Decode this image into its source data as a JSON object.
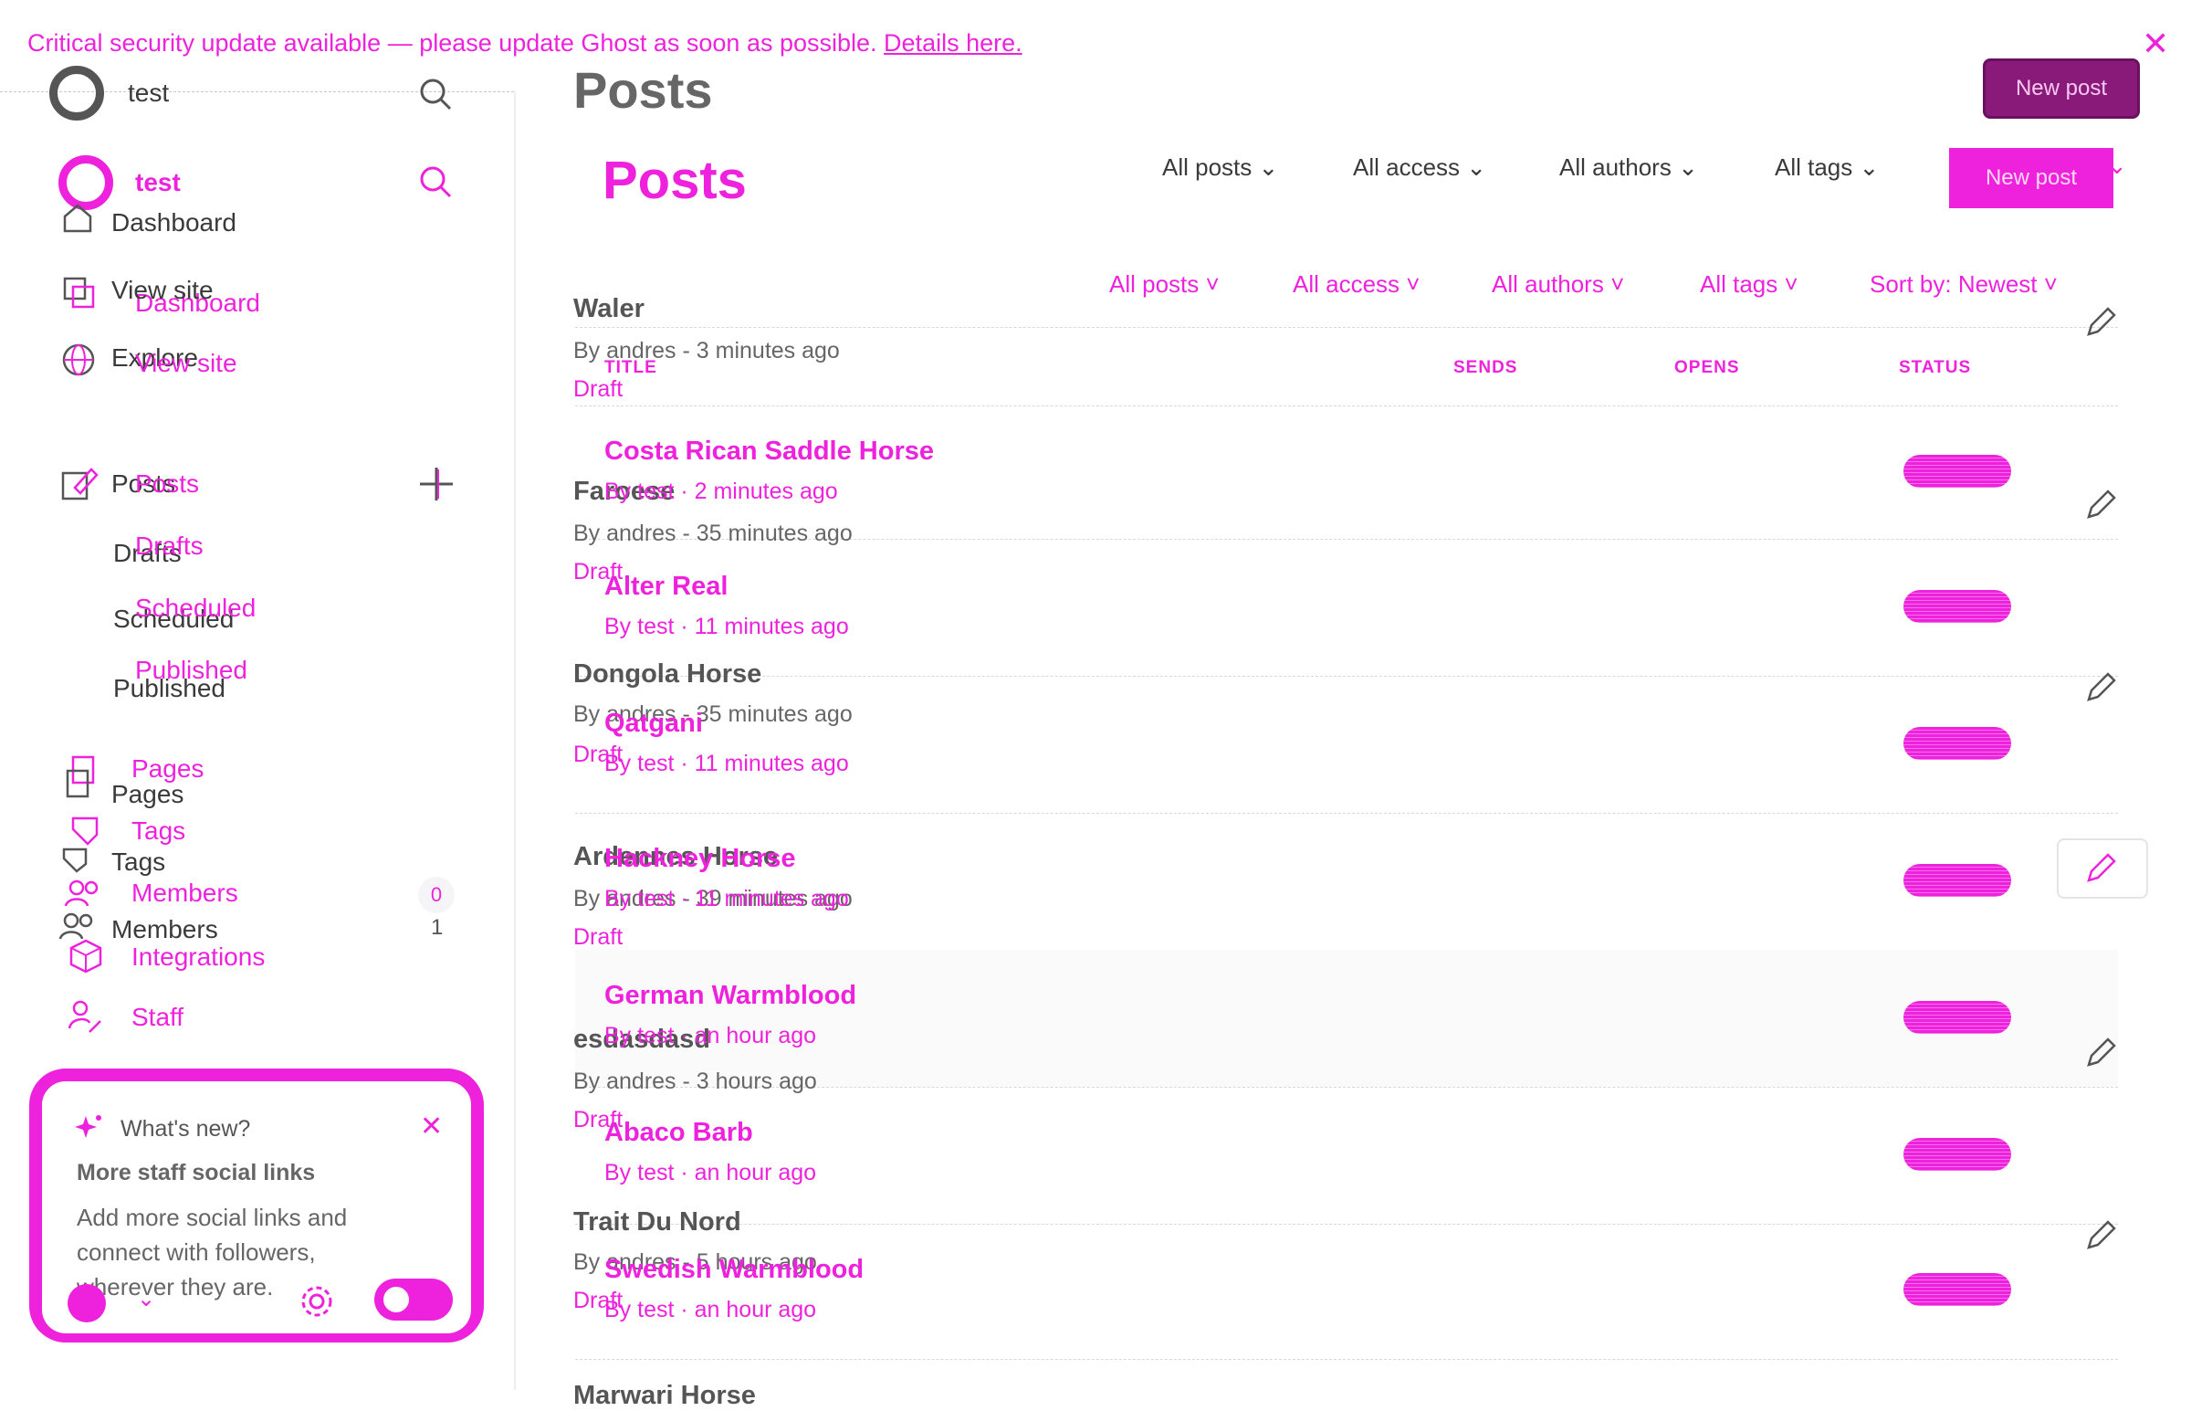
{
  "banner": {
    "message": "Critical security update available — please update Ghost as soon as possible.",
    "link": "Details here."
  },
  "sidebar": {
    "site_name": "test",
    "dashboard": "Dashboard",
    "view_site": "View site",
    "explore": "Explore",
    "posts": "Posts",
    "drafts": "Drafts",
    "scheduled": "Scheduled",
    "published": "Published",
    "pages": "Pages",
    "tags": "Tags",
    "members": "Members",
    "members_count_a": "0",
    "members_count_b": "1",
    "integrations": "Integrations",
    "staff": "Staff"
  },
  "whats_new": {
    "heading": "What's new?",
    "title": "More staff social links",
    "body_line1": "Add more social links and",
    "body_line2": "connect with followers,",
    "body_line3": "wherever they are."
  },
  "header": {
    "title": "Posts",
    "new_post": "New post"
  },
  "filters": {
    "all_posts": "All posts",
    "all_access": "All access",
    "all_authors": "All authors",
    "all_tags": "All tags",
    "sort": "Sort by: Newest"
  },
  "columns": {
    "title": "TITLE",
    "sends": "SENDS",
    "opens": "OPENS",
    "status": "STATUS"
  },
  "posts_a": [
    {
      "title": "Waler",
      "meta": "By andres - 3 minutes ago",
      "status": "Draft"
    },
    {
      "title": "Faroese",
      "meta": "By andres - 35 minutes ago",
      "status": "Draft"
    },
    {
      "title": "Dongola Horse",
      "meta": "By andres - 35 minutes ago",
      "status": "Draft"
    },
    {
      "title": "Ardennes Horse",
      "meta": "By andres - 39 minutes ago",
      "status": "Draft"
    },
    {
      "title": "esdasdasd",
      "meta": "By andres - 3 hours ago",
      "status": "Draft"
    },
    {
      "title": "Trait Du Nord",
      "meta": "By andres - 5 hours ago",
      "status": "Draft"
    },
    {
      "title": "Marwari Horse",
      "meta": "",
      "status": ""
    }
  ],
  "posts_b": [
    {
      "title": "Costa Rican Saddle Horse",
      "meta": "By test · 2 minutes ago"
    },
    {
      "title": "Alter Real",
      "meta": "By test · 11 minutes ago"
    },
    {
      "title": "Qatgani",
      "meta": "By test · 11 minutes ago"
    },
    {
      "title": "Hackney Horse",
      "meta": "By test · 11 minutes ago"
    },
    {
      "title": "German Warmblood",
      "meta": "By test · an hour ago"
    },
    {
      "title": "Abaco Barb",
      "meta": "By test · an hour ago"
    },
    {
      "title": "Swedish Warmblood",
      "meta": "By test · an hour ago"
    }
  ],
  "colors": {
    "accent": "#ee22dd",
    "text": "#15171a"
  },
  "icons": [
    "search-icon",
    "home-icon",
    "view-site-icon",
    "globe-icon",
    "posts-icon",
    "plus-icon",
    "page-icon",
    "tag-icon",
    "members-icon",
    "integrations-icon",
    "staff-icon",
    "sparkle-icon",
    "close-icon",
    "gear-icon",
    "pencil-icon",
    "chevron-down-icon"
  ]
}
